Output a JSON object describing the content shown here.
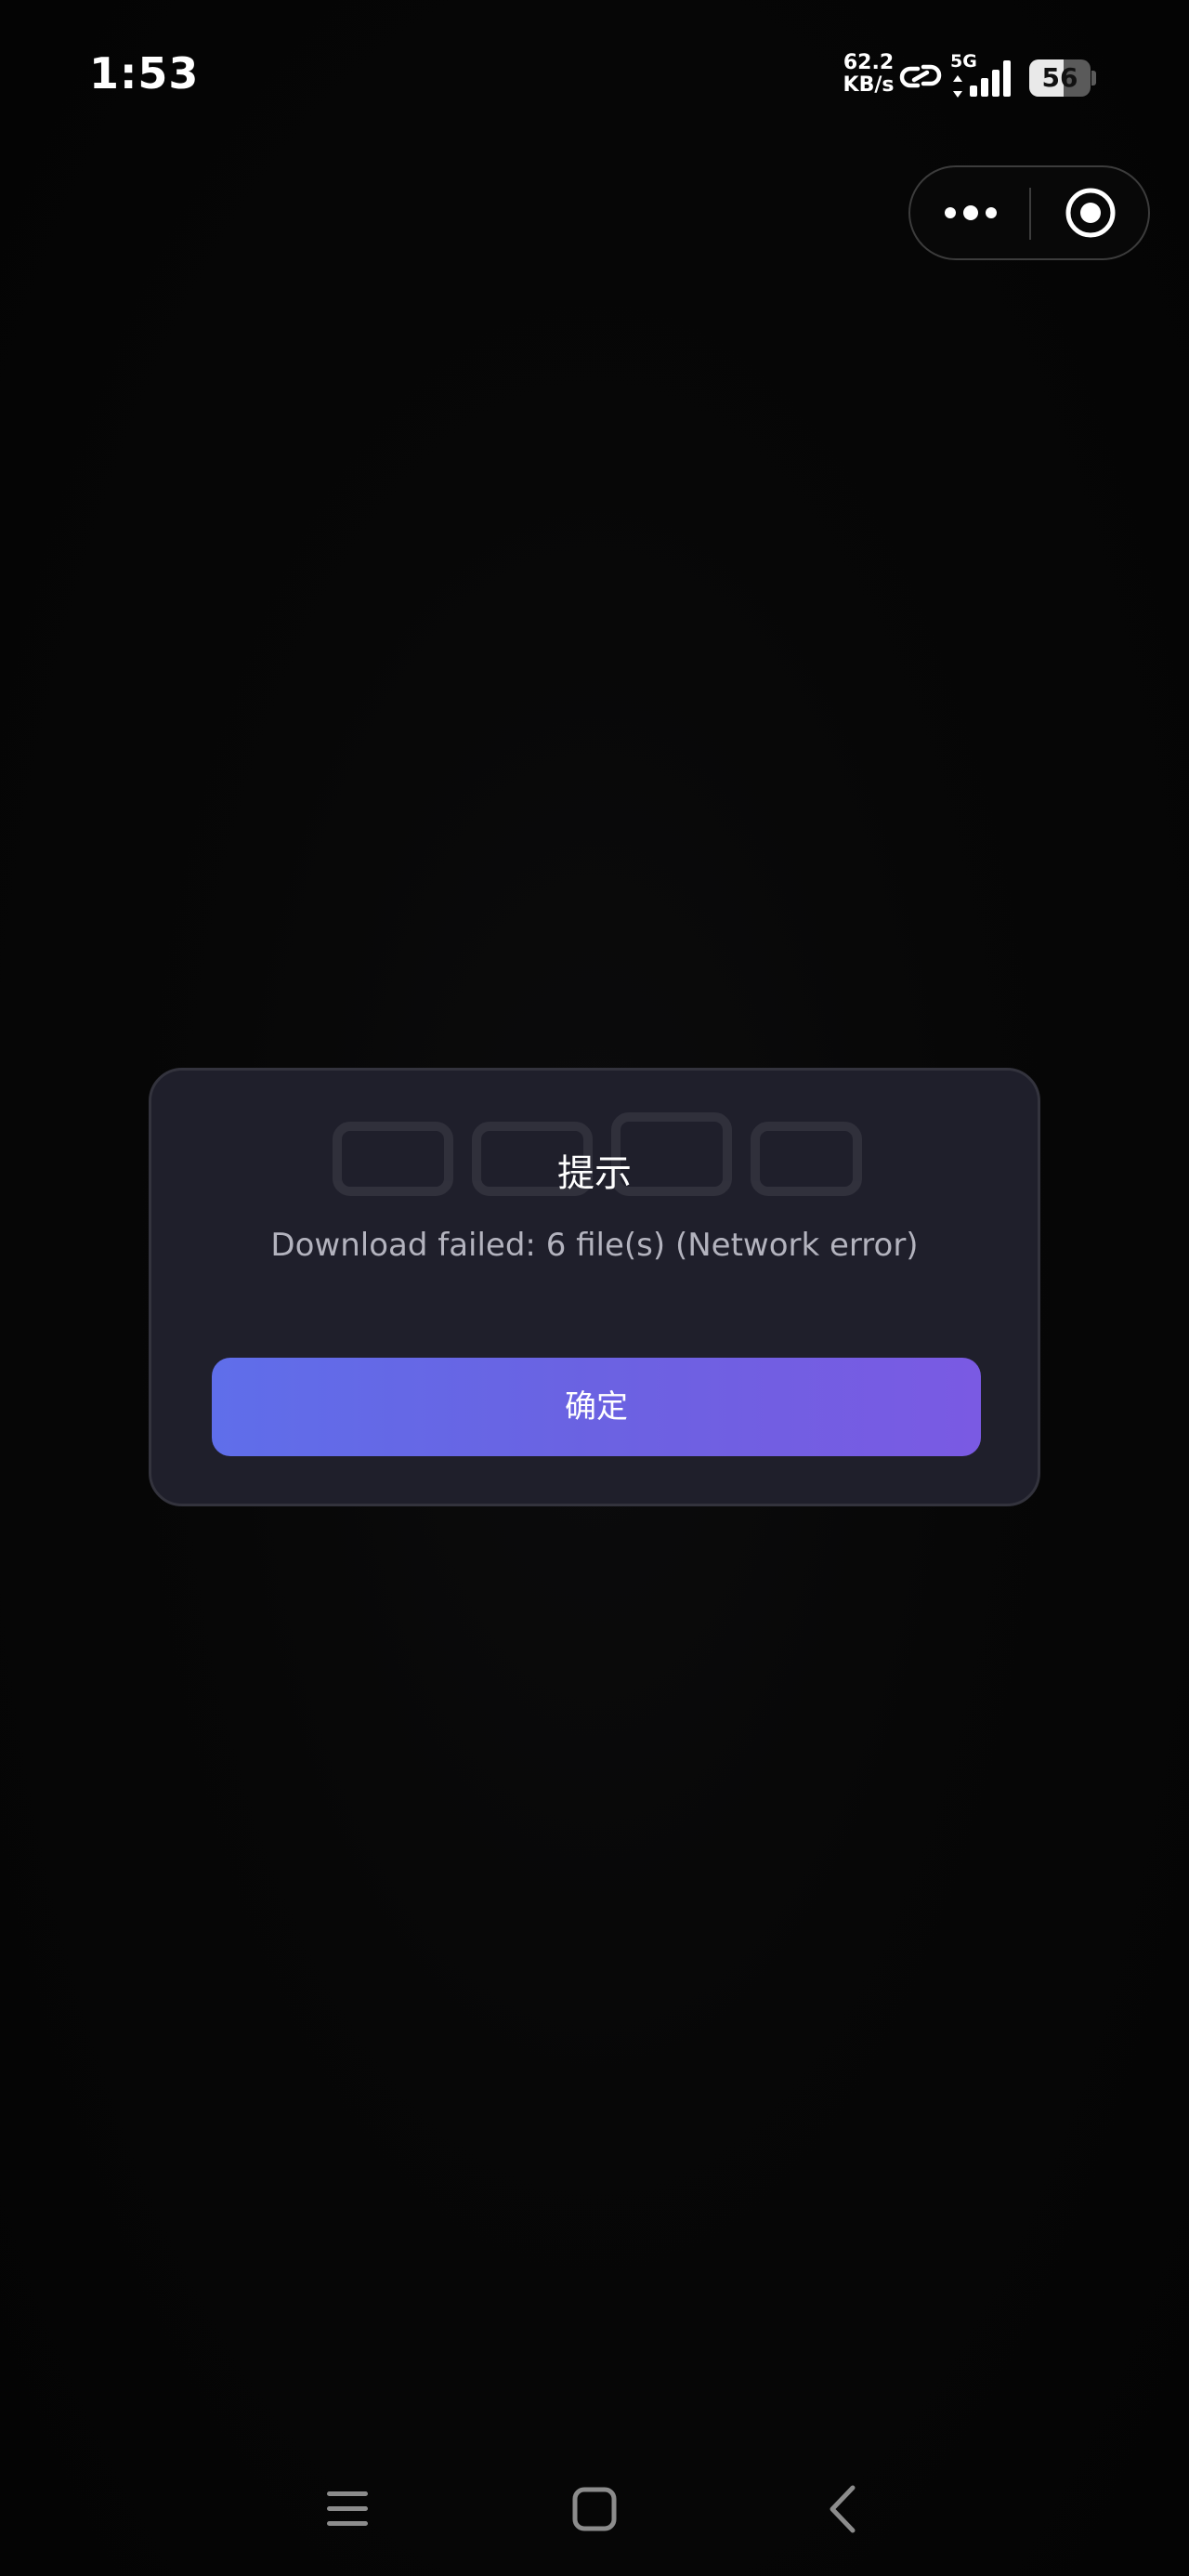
{
  "status_bar": {
    "time": "1:53",
    "net_speed_value": "62.2",
    "net_speed_unit": "KB/s",
    "network_type": "5G",
    "battery_level": "56",
    "battery_fraction": 0.56,
    "icons": [
      "link-icon",
      "signal-icon",
      "battery-icon"
    ]
  },
  "capsule": {
    "icons": [
      "more-dots-icon",
      "close-circle-icon"
    ]
  },
  "modal": {
    "title": "提示",
    "message": "Download failed: 6 file(s) (Network error)",
    "confirm_label": "确定"
  },
  "nav_bar": {
    "icons": [
      "menu-icon",
      "home-icon",
      "back-icon"
    ]
  },
  "colors": {
    "background": "#050505",
    "modal_background": "#1f1f2b",
    "button_gradient_start": "#5f6eea",
    "button_gradient_end": "#7a5ae3",
    "message_text": "#b3b3be"
  }
}
